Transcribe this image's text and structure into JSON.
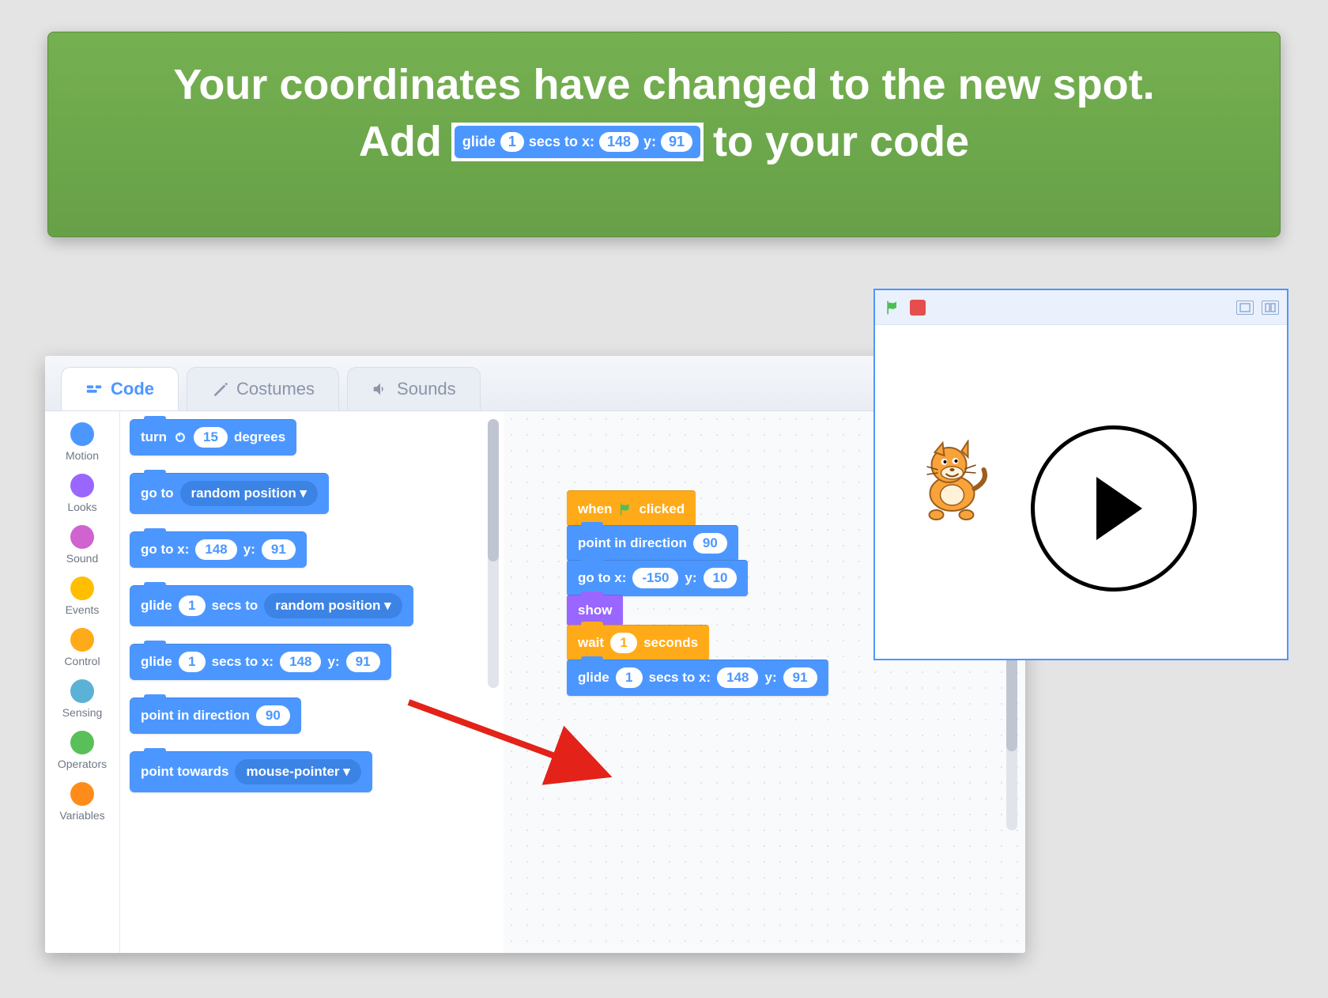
{
  "banner": {
    "line1": "Your coordinates have changed to the new spot.",
    "line2_pre": "Add",
    "line2_post": "to your code",
    "inline_block": {
      "glide": "glide",
      "secsto": "secs to x:",
      "y": "y:",
      "secs": "1",
      "x": "148",
      "yval": "91"
    }
  },
  "tabs": {
    "code": "Code",
    "costumes": "Costumes",
    "sounds": "Sounds"
  },
  "categories": [
    {
      "label": "Motion",
      "color": "#4C97FF"
    },
    {
      "label": "Looks",
      "color": "#9966FF"
    },
    {
      "label": "Sound",
      "color": "#CF63CF"
    },
    {
      "label": "Events",
      "color": "#FFBF00"
    },
    {
      "label": "Control",
      "color": "#FFAB19"
    },
    {
      "label": "Sensing",
      "color": "#5CB1D6"
    },
    {
      "label": "Operators",
      "color": "#59C059"
    },
    {
      "label": "Variables",
      "color": "#FF8C1A"
    }
  ],
  "palette": {
    "turn_l": "turn",
    "turn_deg": "15",
    "degrees": "degrees",
    "goto": "go to",
    "random_pos": "random position ▾",
    "gotoxy": "go to x:",
    "y": "y:",
    "gx": "148",
    "gy": "91",
    "glide": "glide",
    "secsto": "secs to",
    "glide_secs": "1",
    "secstoxy": "secs to x:",
    "gl2_secs": "1",
    "gl2_x": "148",
    "gl2_y": "91",
    "pointdir": "point in direction",
    "dir": "90",
    "pointtowards": "point towards",
    "mouse": "mouse-pointer ▾"
  },
  "script": {
    "when": "when",
    "clicked": "clicked",
    "pointdir": "point in direction",
    "dir": "90",
    "gotoxy": "go to x:",
    "gx": "-150",
    "y": "y:",
    "gy": "10",
    "show": "show",
    "wait": "wait",
    "waitv": "1",
    "seconds": "seconds",
    "glide": "glide",
    "gsecs": "1",
    "secstoxy": "secs to x:",
    "glx": "148",
    "gly": "91"
  }
}
